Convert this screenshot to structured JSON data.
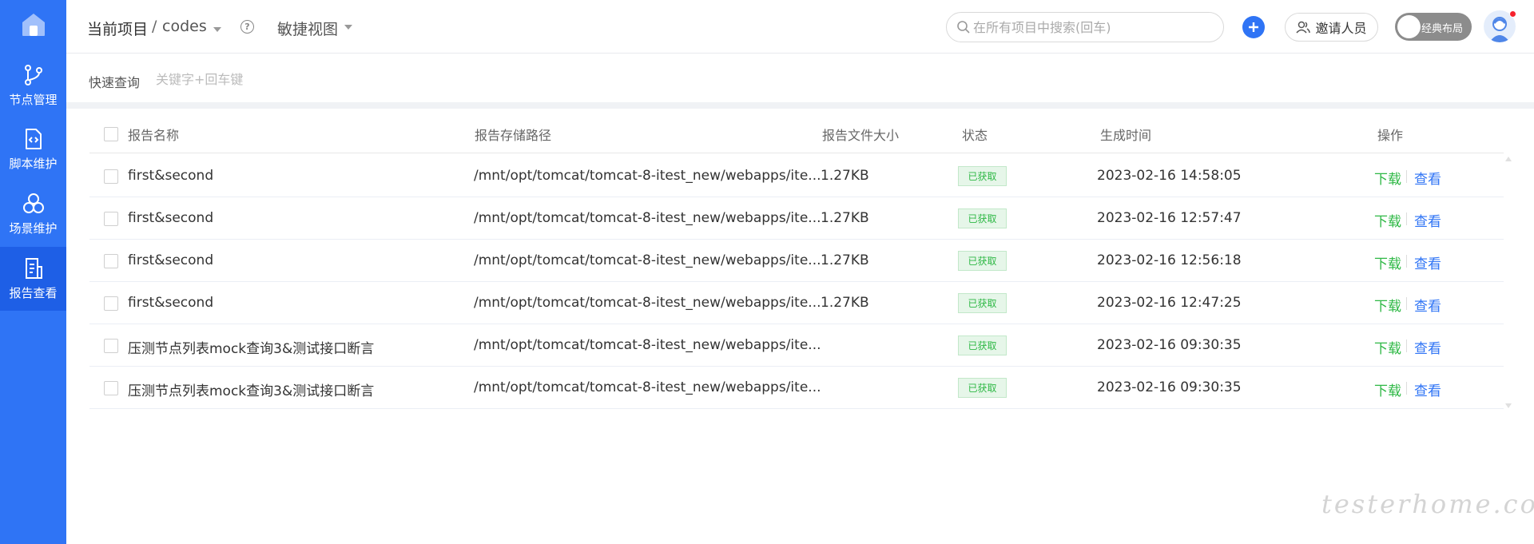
{
  "sidebar": {
    "items": [
      {
        "label": "节点管理",
        "icon": "branch-icon"
      },
      {
        "label": "脚本维护",
        "icon": "code-file-icon"
      },
      {
        "label": "场景维护",
        "icon": "scene-icon"
      },
      {
        "label": "报告查看",
        "icon": "report-icon",
        "active": true
      }
    ]
  },
  "header": {
    "project_label": "当前项目",
    "separator": "/",
    "project_name": "codes",
    "view_label": "敏捷视图",
    "search_placeholder": "在所有项目中搜索(回车)",
    "invite_label": "邀请人员",
    "layout_toggle_label": "经典布局"
  },
  "quick_query": {
    "label": "快速查询",
    "placeholder": "关键字+回车键"
  },
  "table": {
    "columns": [
      "报告名称",
      "报告存储路径",
      "报告文件大小",
      "状态",
      "生成时间",
      "操作"
    ],
    "rows": [
      {
        "name": "first&second",
        "path": "/mnt/opt/tomcat/tomcat-8-itest_new/webapps/ite...",
        "size": "1.27KB",
        "status": "已获取",
        "time": "2023-02-16 14:58:05"
      },
      {
        "name": "first&second",
        "path": "/mnt/opt/tomcat/tomcat-8-itest_new/webapps/ite...",
        "size": "1.27KB",
        "status": "已获取",
        "time": "2023-02-16 12:57:47"
      },
      {
        "name": "first&second",
        "path": "/mnt/opt/tomcat/tomcat-8-itest_new/webapps/ite...",
        "size": "1.27KB",
        "status": "已获取",
        "time": "2023-02-16 12:56:18"
      },
      {
        "name": "first&second",
        "path": "/mnt/opt/tomcat/tomcat-8-itest_new/webapps/ite...",
        "size": "1.27KB",
        "status": "已获取",
        "time": "2023-02-16 12:47:25"
      },
      {
        "name": "压测节点列表mock查询3&测试接口断言",
        "path": "/mnt/opt/tomcat/tomcat-8-itest_new/webapps/ite...",
        "size": "",
        "status": "已获取",
        "time": "2023-02-16 09:30:35"
      },
      {
        "name": "压测节点列表mock查询3&测试接口断言",
        "path": "/mnt/opt/tomcat/tomcat-8-itest_new/webapps/ite...",
        "size": "",
        "status": "已获取",
        "time": "2023-02-16 09:30:35"
      }
    ],
    "download_label": "下载",
    "view_label": "查看"
  },
  "watermark": "testerhome.com",
  "colors": {
    "sidebar": "#2f74f5",
    "sidebar_active": "#1e5fe6",
    "status_green": "#2eb845",
    "link_blue": "#2f74f5"
  }
}
